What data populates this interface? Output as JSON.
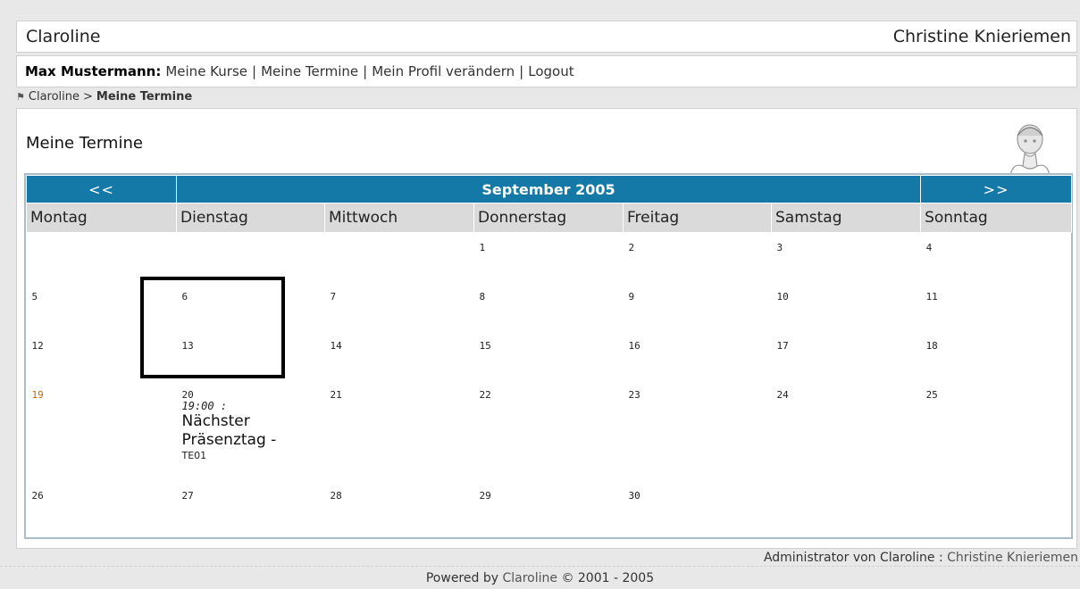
{
  "header": {
    "site_name": "Claroline",
    "institution": "Christine Knieriemen"
  },
  "userbar": {
    "user_name": "Max Mustermann",
    "colon": " :",
    "links": [
      "Meine Kurse",
      "Meine Termine",
      "Mein Profil verändern",
      "Logout"
    ]
  },
  "breadcrumb": {
    "root": "Claroline",
    "separator": ">",
    "current": "Meine Termine"
  },
  "page": {
    "title": "Meine Termine"
  },
  "calendar": {
    "prev": "<<",
    "month_label": "September 2005",
    "next": ">>",
    "weekdays": [
      "Montag",
      "Dienstag",
      "Mittwoch",
      "Donnerstag",
      "Freitag",
      "Samstag",
      "Sonntag"
    ],
    "weeks": [
      [
        "",
        "",
        "",
        "1",
        "2",
        "3",
        "4"
      ],
      [
        "5",
        "6",
        "7",
        "8",
        "9",
        "10",
        "11"
      ],
      [
        "12",
        "13",
        "14",
        "15",
        "16",
        "17",
        "18"
      ],
      [
        "19",
        "20",
        "21",
        "22",
        "23",
        "24",
        "25"
      ],
      [
        "26",
        "27",
        "28",
        "29",
        "30",
        "",
        ""
      ]
    ],
    "today": "19",
    "event": {
      "day": "20",
      "time": "19:00 :",
      "title": "Nächster Präsenztag -",
      "code": "TE01"
    }
  },
  "footer": {
    "admin_label": "Administrator von Claroline :",
    "admin_name": "Christine Knieriemen",
    "powered_prefix": "Powered by",
    "powered_link": "Claroline",
    "powered_suffix": "© 2001 - 2005"
  },
  "colors": {
    "nav_blue": "#1479a7",
    "today": "#cc6600"
  }
}
